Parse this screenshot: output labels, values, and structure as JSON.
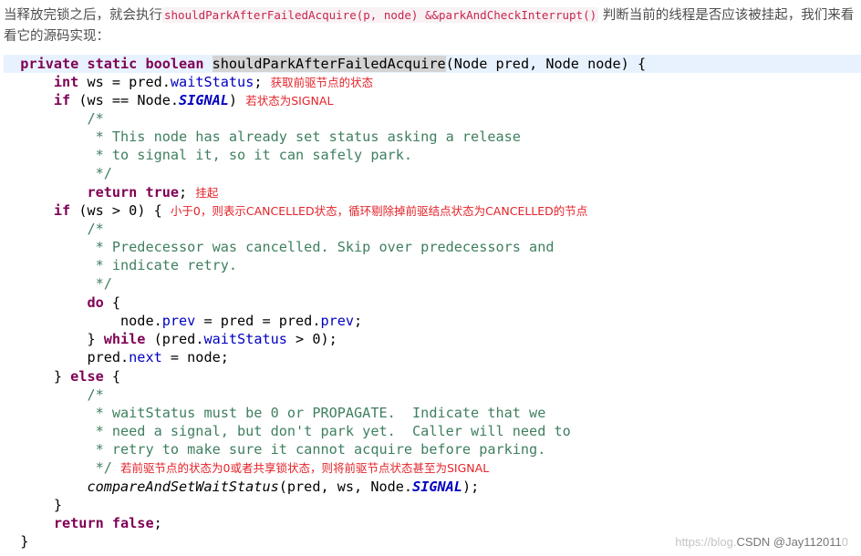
{
  "intro": {
    "before_code": "当释放完锁之后，就会执行",
    "inline_code": "shouldParkAfterFailedAcquire(p, node) &&parkAndCheckInterrupt()",
    "after_code": "判断当前的线程是否应该被挂起，我们来看看它的源码实现："
  },
  "code": {
    "l1_kw": "private static boolean",
    "l1_method": "shouldParkAfterFailedAcquire",
    "l1_rest": "(Node pred, Node node) {",
    "l2_kw": "int",
    "l2_a": " ws = pred.",
    "l2_field": "waitStatus",
    "l2_end": ";",
    "l2_ann": "获取前驱节点的状态",
    "l3_kw": "if",
    "l3_a": " (ws == Node.",
    "l3_const": "SIGNAL",
    "l3_end": ")",
    "l3_ann": "若状态为SIGNAL",
    "l4": "/*",
    "l5": " * This node has already set status asking a release",
    "l6": " * to signal it, so it can safely park.",
    "l7": " */",
    "l8_kw": "return true",
    "l8_end": ";",
    "l8_ann": "挂起",
    "l9_kw": "if",
    "l9_a": " (ws > 0) {",
    "l9_ann": "小于0，则表示CANCELLED状态，循环剔除掉前驱结点状态为CANCELLED的节点",
    "l10": "/*",
    "l11": " * Predecessor was cancelled. Skip over predecessors and",
    "l12": " * indicate retry.",
    "l13": " */",
    "l14_kw": "do",
    "l14_a": " {",
    "l15_a": "node.",
    "l15_f1": "prev",
    "l15_b": " = pred = pred.",
    "l15_f2": "prev",
    "l15_c": ";",
    "l16_a": "} ",
    "l16_kw": "while",
    "l16_b": " (pred.",
    "l16_field": "waitStatus",
    "l16_c": " > 0);",
    "l17_a": "pred.",
    "l17_field": "next",
    "l17_b": " = node;",
    "l18_a": "} ",
    "l18_kw": "else",
    "l18_b": " {",
    "l19": "/*",
    "l20": " * waitStatus must be 0 or PROPAGATE.  Indicate that we",
    "l21": " * need a signal, but don't park yet.  Caller will need to",
    "l22": " * retry to make sure it cannot acquire before parking.",
    "l23": " */",
    "l23_ann": "若前驱节点的状态为0或者共享锁状态，则将前驱节点状态甚至为SIGNAL",
    "l24_method": "compareAndSetWaitStatus",
    "l24_a": "(pred, ws, Node.",
    "l24_const": "SIGNAL",
    "l24_b": ");",
    "l25": "}",
    "l26_kw": "return false",
    "l26_end": ";",
    "l27": "}"
  },
  "watermark": {
    "faded": "https://blog.",
    "main": "CSDN @Jay112011",
    "tail": "0"
  }
}
